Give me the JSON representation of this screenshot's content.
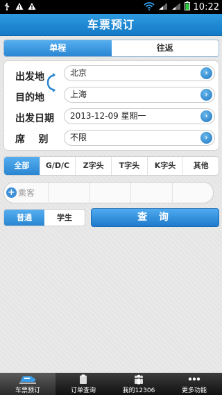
{
  "status_bar": {
    "time": "10:22"
  },
  "header": {
    "title": "车票预订"
  },
  "trip_type": {
    "options": [
      "单程",
      "往返"
    ],
    "selected": 0
  },
  "form": {
    "from_label": "出发地",
    "from_value": "北京",
    "to_label": "目的地",
    "to_value": "上海",
    "date_label": "出发日期",
    "date_value": "2013-12-09 星期一",
    "seat_label": "席    别",
    "seat_value": "不限"
  },
  "train_filter": {
    "options": [
      "全部",
      "G/D/C",
      "Z字头",
      "T字头",
      "K字头",
      "其他"
    ],
    "selected": 0
  },
  "passenger": {
    "add_label": "乘客"
  },
  "ticket_type": {
    "options": [
      "普通",
      "学生"
    ],
    "selected": 0
  },
  "search_button": "查 询",
  "bottom_nav": {
    "items": [
      "车票预订",
      "订单查询",
      "我的12306",
      "更多功能"
    ],
    "selected": 0
  },
  "colors": {
    "accent": "#1e80cd",
    "header": "#1479c7"
  }
}
